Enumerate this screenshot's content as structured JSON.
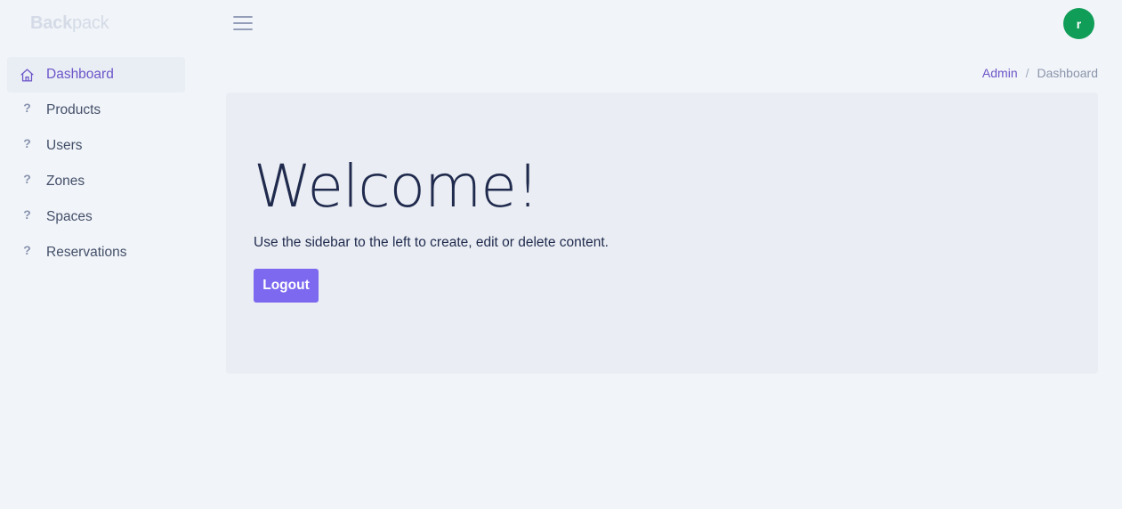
{
  "brand": {
    "part1": "Back",
    "part2": "pack"
  },
  "header": {
    "menu_icon": "hamburger-icon",
    "avatar_letter": "r",
    "avatar_color": "#0f9d58"
  },
  "sidebar": {
    "items": [
      {
        "label": "Dashboard",
        "icon": "home-icon",
        "active": true
      },
      {
        "label": "Products",
        "icon": "question-icon",
        "active": false
      },
      {
        "label": "Users",
        "icon": "question-icon",
        "active": false
      },
      {
        "label": "Zones",
        "icon": "question-icon",
        "active": false
      },
      {
        "label": "Spaces",
        "icon": "question-icon",
        "active": false
      },
      {
        "label": "Reservations",
        "icon": "question-icon",
        "active": false
      }
    ]
  },
  "breadcrumb": {
    "parent": "Admin",
    "separator": "/",
    "current": "Dashboard"
  },
  "main": {
    "heading": "Welcome!",
    "lead": "Use the sidebar to the left to create, edit or delete content.",
    "logout_label": "Logout"
  },
  "colors": {
    "accent": "#7c69ef",
    "active_text": "#6b55c9",
    "background": "#f1f4f8",
    "card": "#eaedf3"
  }
}
